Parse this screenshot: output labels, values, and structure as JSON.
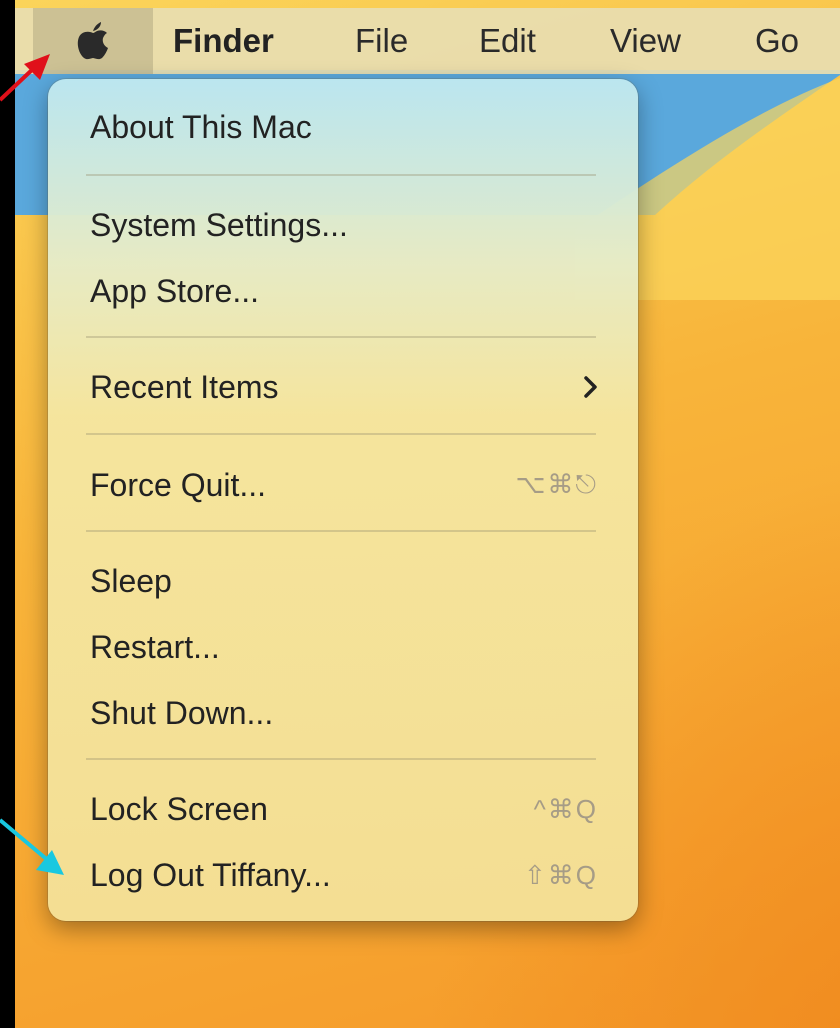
{
  "menubar": {
    "app_name": "Finder",
    "items": [
      "File",
      "Edit",
      "View",
      "Go"
    ]
  },
  "apple_menu": {
    "about": "About This Mac",
    "system_settings": "System Settings...",
    "app_store": "App Store...",
    "recent_items": "Recent Items",
    "force_quit": "Force Quit...",
    "force_quit_shortcut": "⌥⌘⎋",
    "sleep": "Sleep",
    "restart": "Restart...",
    "shut_down": "Shut Down...",
    "lock_screen": "Lock Screen",
    "lock_screen_shortcut": "^⌘Q",
    "log_out": "Log Out Tiffany...",
    "log_out_shortcut": "⇧⌘Q"
  },
  "colors": {
    "menu_background": "#f4e096",
    "wallpaper": "#f8b43a",
    "annotation_red_arrow": "#e0101a",
    "annotation_cyan_arrow": "#19c8e0"
  }
}
